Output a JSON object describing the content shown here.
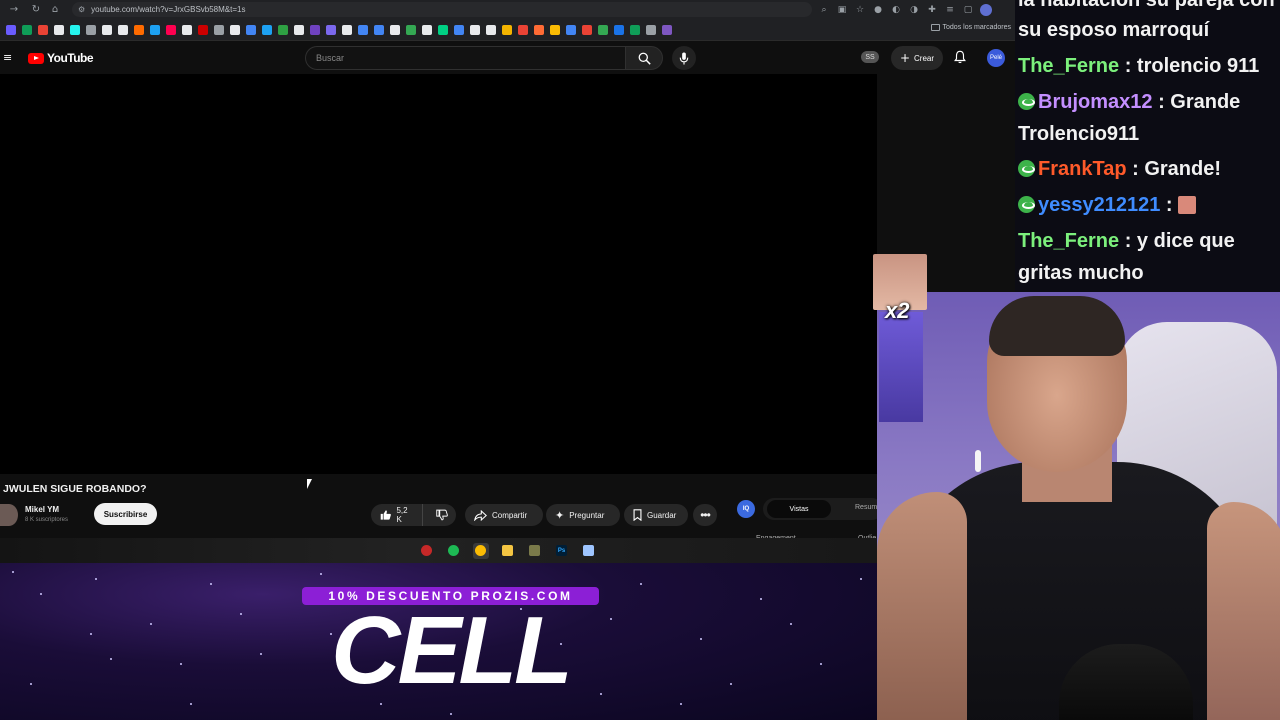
{
  "browser": {
    "url": "youtube.com/watch?v=JrxGBSvb58M&t=1s",
    "bookmarks_all_label": "Todos los marcadores",
    "bookmark_colors": [
      "#6a5cff",
      "#0f9d58",
      "#ea4335",
      "#e8eaed",
      "#25f4ee",
      "#9aa0a6",
      "#e8eaed",
      "#e8eaed",
      "#ff6b00",
      "#1da1f2",
      "#ff0050",
      "#e8eaed",
      "#cc0000",
      "#9aa0a6",
      "#e8eaed",
      "#4285f4",
      "#1da1f2",
      "#2ea043",
      "#e8eaed",
      "#6f42c1",
      "#7b68ee",
      "#e8eaed",
      "#4285f4",
      "#4285f4",
      "#e8eaed",
      "#34a853",
      "#e8eaed",
      "#00d084",
      "#4285f4",
      "#e8eaed",
      "#e8eaed",
      "#f4b400",
      "#ea4335",
      "#ff6b35",
      "#fbbc04",
      "#4285f4",
      "#ea4335",
      "#34a853",
      "#1a73e8",
      "#0f9d58",
      "#9aa0a6",
      "#7e57c2"
    ]
  },
  "youtube": {
    "logo_text": "YouTube",
    "search_placeholder": "Buscar",
    "ss_badge": "SS",
    "create_label": "Crear",
    "avatar_text": "Pelé",
    "video": {
      "title": "JWULEN SIGUE ROBANDO?",
      "channel_name": "Mikel YM",
      "subscribers": "8 K suscriptores",
      "subscribe_label": "Suscribirse",
      "likes": "5,2 K",
      "share_label": "Compartir",
      "ask_label": "Preguntar",
      "save_label": "Guardar"
    },
    "extension": {
      "icon_text": "IQ",
      "tab_active": "Vistas",
      "tab_inactive": "Resum",
      "label_engagement": "Engagement",
      "label_outlier": "Outlie"
    }
  },
  "taskbar": {
    "apps": [
      {
        "name": "obs-icon",
        "color": "#c62828"
      },
      {
        "name": "spotify-icon",
        "color": "#1db954"
      },
      {
        "name": "chrome-icon",
        "color": "#fbbc04"
      },
      {
        "name": "folder-icon",
        "color": "#f4c542"
      },
      {
        "name": "app-icon",
        "color": "#7a7a4a"
      },
      {
        "name": "photoshop-icon",
        "color": "#001e36"
      },
      {
        "name": "paint-icon",
        "color": "#9ec5ff"
      }
    ],
    "photoshop_text": "Ps"
  },
  "overlay": {
    "promo_text": "10% DESCUENTO PROZIS.COM",
    "brand_logo": "CELL",
    "alert_multiplier": "x2"
  },
  "chat": {
    "lines": [
      {
        "user": "",
        "message": "la habitación su pareja con",
        "color": ""
      },
      {
        "user": "",
        "message": "su esposo marroquí",
        "color": ""
      },
      {
        "user": "The_Ferne",
        "message": ": trolencio 911",
        "color": "green"
      },
      {
        "user": "Brujomax12",
        "message": ": Grande",
        "color": "purple"
      },
      {
        "user": "",
        "message": "Trolencio911",
        "color": ""
      },
      {
        "user": "FrankTap",
        "message": ": Grande!",
        "color": "red"
      },
      {
        "user": "yessy212121",
        "message": ":",
        "color": "blue"
      },
      {
        "user": "The_Ferne",
        "message": ": y dice que",
        "color": "green"
      },
      {
        "user": "",
        "message": "gritas mucho",
        "color": ""
      }
    ]
  }
}
